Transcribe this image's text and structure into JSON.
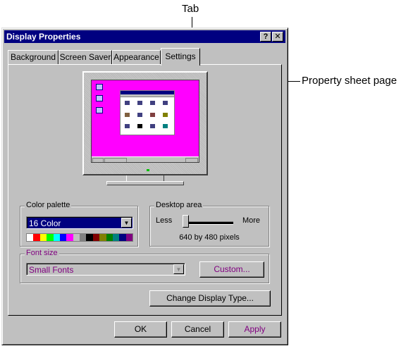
{
  "annotations": {
    "tab": "Tab",
    "property_sheet_page": "Property sheet page"
  },
  "window": {
    "title": "Display Properties",
    "help_btn": "?",
    "close_btn": "✕"
  },
  "tabs": [
    {
      "label": "Background",
      "active": false
    },
    {
      "label": "Screen Saver",
      "active": false
    },
    {
      "label": "Appearance",
      "active": false
    },
    {
      "label": "Settings",
      "active": true
    }
  ],
  "color_palette": {
    "label": "Color palette",
    "value": "16 Color",
    "swatches": [
      "#ffffff",
      "#ff0000",
      "#ffff00",
      "#00ff00",
      "#00ffff",
      "#0000ff",
      "#ff00ff",
      "#c0c0c0",
      "#808080",
      "#000000",
      "#800000",
      "#808000",
      "#008000",
      "#008080",
      "#000080",
      "#800080"
    ]
  },
  "desktop_area": {
    "label": "Desktop area",
    "less": "Less",
    "more": "More",
    "resolution": "640 by 480 pixels",
    "slider_fraction": 0
  },
  "font_size": {
    "label": "Font size",
    "value": "Small Fonts",
    "custom_button": "Custom..."
  },
  "change_display_type_button": "Change Display Type...",
  "footer": {
    "ok": "OK",
    "cancel": "Cancel",
    "apply": "Apply"
  }
}
